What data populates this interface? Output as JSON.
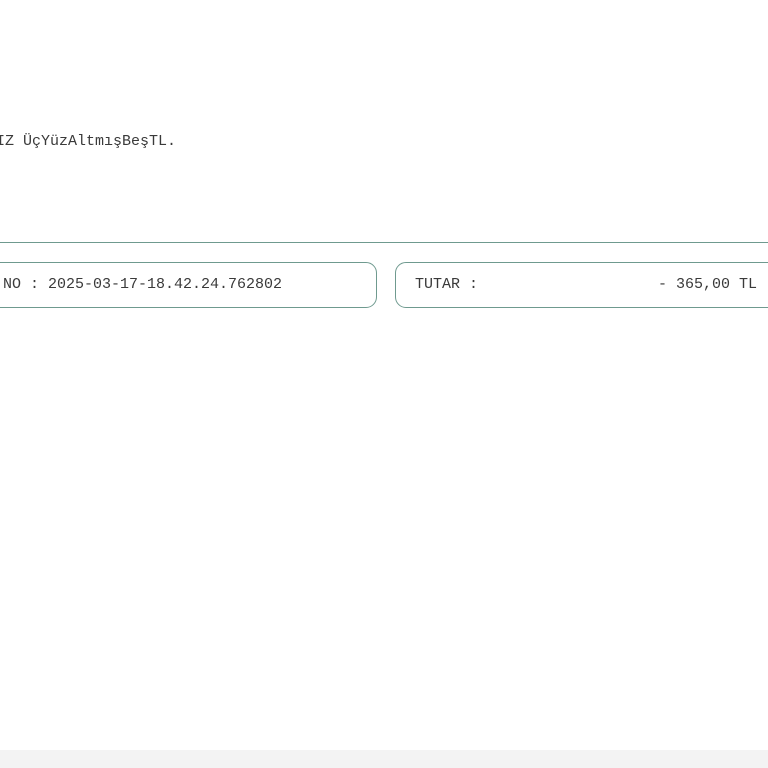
{
  "document": {
    "amount_in_words": "IZ ÜçYüzAltmışBeşTL.",
    "reference": {
      "text": "NO : 2025-03-17-18.42.24.762802"
    },
    "amount": {
      "label": "TUTAR :",
      "value": "- 365,00 TL"
    }
  },
  "colors": {
    "border": "#6f9a8f",
    "text": "#3a3a3a",
    "footer": "#f3f3f3"
  }
}
